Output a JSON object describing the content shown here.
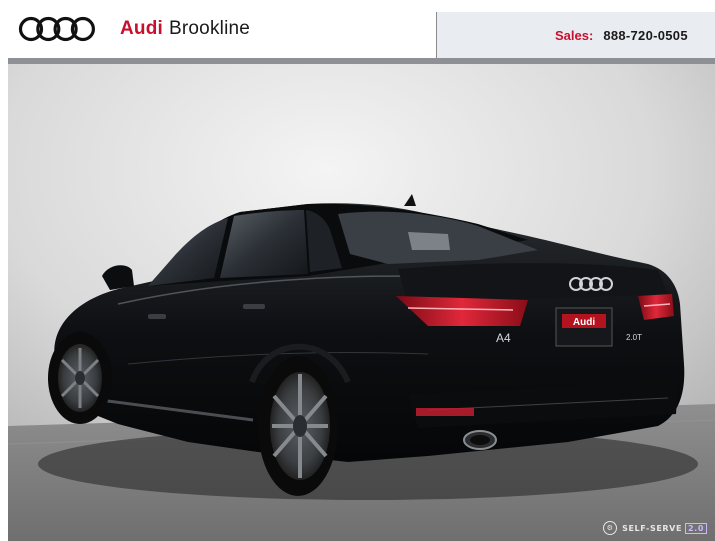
{
  "header": {
    "brand": "Audi",
    "location": "Brookline",
    "logo_icon": "audi-rings-icon",
    "sales_label": "Sales:",
    "sales_phone": "888-720-0505",
    "accent_color": "#c8102e",
    "sales_bg": "#e9edf2"
  },
  "photo": {
    "car_badge": "A4",
    "trim_badge": "2.0T",
    "plate_brand": "Audi",
    "watermark": {
      "icon": "self-serve-icon",
      "text": "SELF-SERVE",
      "version": "2.0"
    }
  }
}
